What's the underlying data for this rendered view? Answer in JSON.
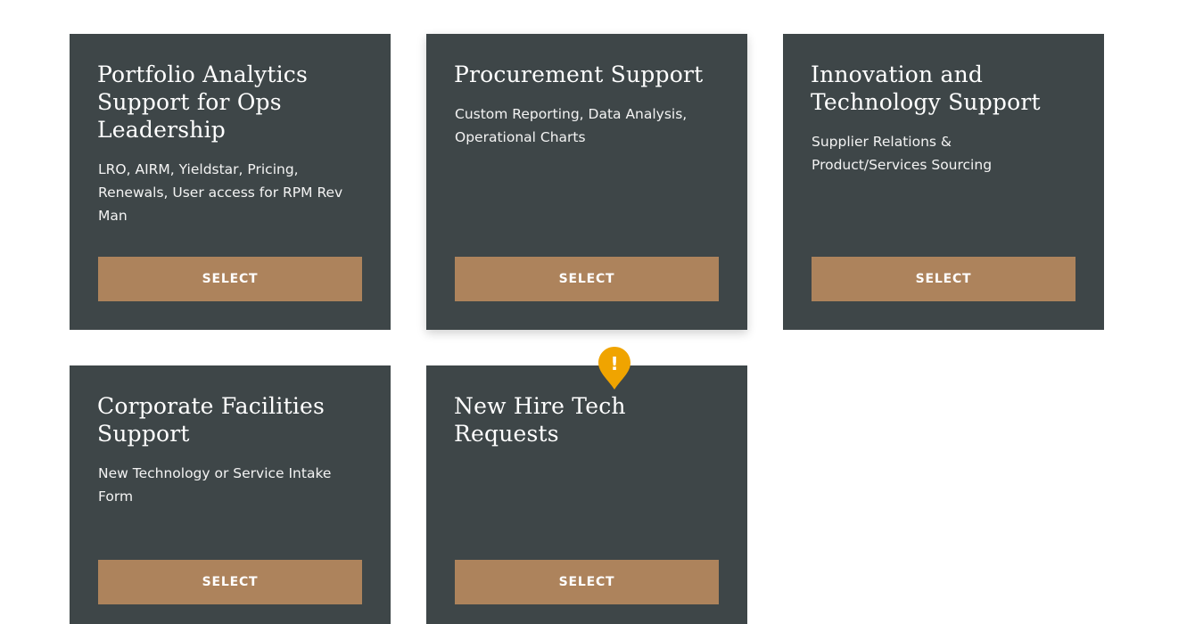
{
  "cards": [
    {
      "title": "Portfolio Analytics Support for Ops Leadership",
      "description": "LRO, AIRM, Yieldstar, Pricing, Renewals, User access for RPM Rev Man",
      "button_label": "SELECT"
    },
    {
      "title": "Procurement Support",
      "description": "Custom Reporting, Data Analysis, Operational Charts",
      "button_label": "SELECT"
    },
    {
      "title": "Innovation and Technology Support",
      "description": "Supplier Relations & Product/Services Sourcing",
      "button_label": "SELECT"
    },
    {
      "title": "Corporate Facilities Support",
      "description": "New Technology or Service Intake Form",
      "button_label": "SELECT"
    },
    {
      "title": "New Hire Tech Requests",
      "description": "",
      "button_label": "SELECT"
    }
  ],
  "alert_marker": {
    "icon": "exclamation-pin-icon",
    "glyph": "!",
    "color": "#f0a400"
  },
  "colors": {
    "card_background": "#3e4648",
    "button_background": "#ad835c",
    "text": "#ffffff"
  }
}
